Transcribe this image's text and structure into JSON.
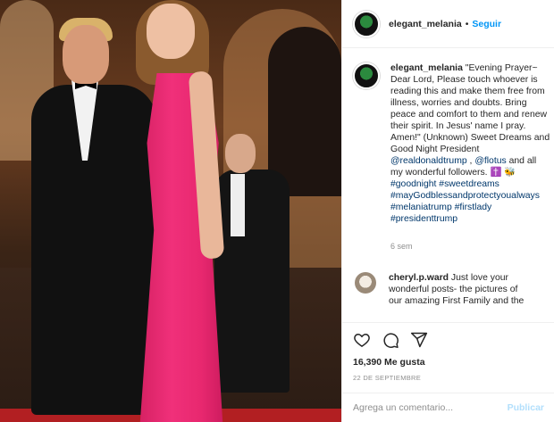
{
  "header": {
    "username": "elegant_melania",
    "separator": "•",
    "follow_label": "Seguir"
  },
  "caption": {
    "username": "elegant_melania",
    "lines": [
      "\"Evening Prayer~",
      "Dear Lord, Please touch whoever is",
      "reading this and make them free from",
      "illness, worries and doubts. Bring",
      "peace and comfort to them and renew",
      "their spirit. In Jesus' name I pray.",
      "Amen!\" (Unknown) Sweet Dreams and",
      "Good Night President"
    ],
    "mention1": "@realdonaldtrump",
    "comma": " , ",
    "mention2": "@flotus",
    "after_mention2": " and all",
    "line_followers": "my wonderful followers. ✝️ 🐝",
    "hashtags": [
      "#goodnight #sweetdreams",
      "#mayGodblessandprotectyoualways",
      "#melaniatrump #firstlady",
      "#presidenttrump"
    ],
    "age": "6 sem"
  },
  "comment": {
    "username": "cheryl.p.ward",
    "lines": [
      " Just love your",
      "wonderful posts- the pictures of",
      "our amazing First Family and the"
    ]
  },
  "actions": {
    "icons": [
      "heart-icon",
      "comment-icon",
      "share-icon"
    ],
    "likes": "16,390 Me gusta",
    "date": "22 DE SEPTIEMBRE"
  },
  "add_comment": {
    "placeholder": "Agrega un comentario...",
    "publish_label": "Publicar"
  },
  "colors": {
    "link": "#00376b",
    "follow": "#0095f6",
    "publish_disabled": "#b2dffc",
    "dress": "#f0307a"
  }
}
